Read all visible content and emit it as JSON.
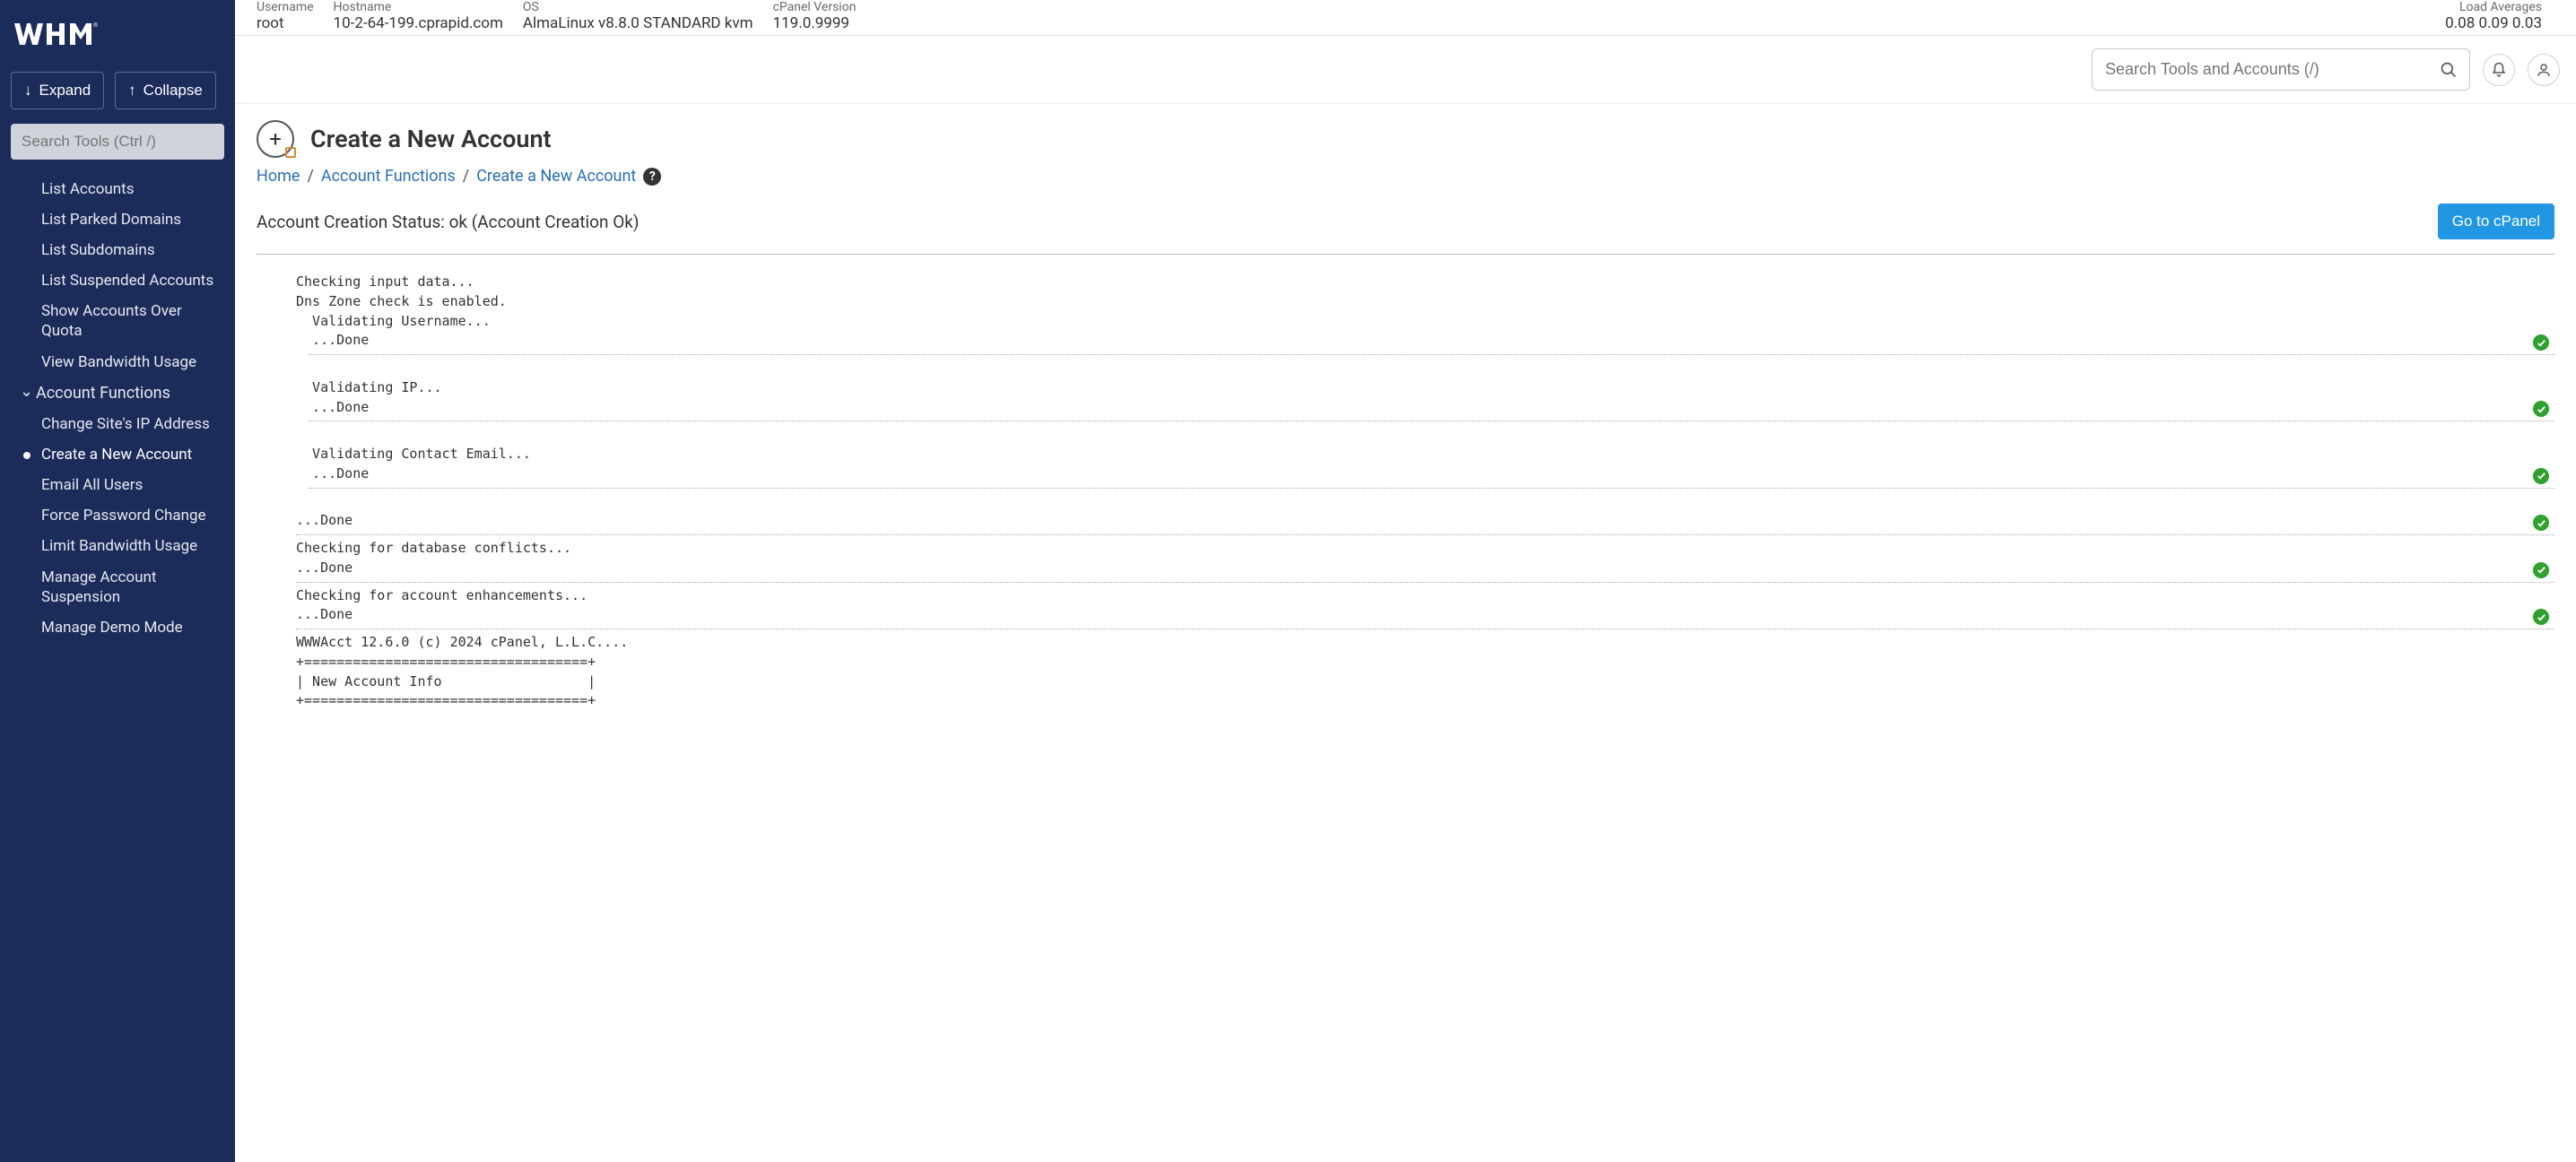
{
  "topbar": {
    "username_label": "Username",
    "username_value": "root",
    "hostname_label": "Hostname",
    "hostname_value": "10-2-64-199.cprapid.com",
    "os_label": "OS",
    "os_value": "AlmaLinux v8.8.0 STANDARD kvm",
    "cpv_label": "cPanel Version",
    "cpv_value": "119.0.9999",
    "load_label": "Load Averages",
    "load_values": "0.08   0.09   0.03"
  },
  "sidebar": {
    "expand": "Expand",
    "collapse": "Collapse",
    "search_placeholder": "Search Tools (Ctrl /)",
    "items_top": [
      "List Accounts",
      "List Parked Domains",
      "List Subdomains",
      "List Suspended Accounts",
      "Show Accounts Over Quota",
      "View Bandwidth Usage"
    ],
    "category": "Account Functions",
    "items_bottom": [
      "Change Site's IP Address",
      "Create a New Account",
      "Email All Users",
      "Force Password Change",
      "Limit Bandwidth Usage",
      "Manage Account Suspension",
      "Manage Demo Mode"
    ]
  },
  "tools": {
    "search_placeholder": "Search Tools and Accounts (/)"
  },
  "page": {
    "title": "Create a New Account",
    "breadcrumb": {
      "home": "Home",
      "func": "Account Functions",
      "current": "Create a New Account"
    },
    "status": "Account Creation Status: ok (Account Creation Ok)",
    "go_btn": "Go to cPanel"
  },
  "log": {
    "l0": "Checking input data...",
    "l1": "Dns Zone check is enabled.",
    "g1a": "  Validating Username...",
    "g1b": "  ...Done",
    "g2a": "  Validating IP...",
    "g2b": "  ...Done",
    "g3a": "  Validating Contact Email...",
    "g3b": "  ...Done",
    "l2": "...Done",
    "l3a": "Checking for database conflicts...",
    "l3b": "...Done",
    "l4a": "Checking for account enhancements...",
    "l4b": "...Done",
    "l5": "WWWAcct 12.6.0 (c) 2024 cPanel, L.L.C....",
    "l6": "",
    "l7": "+===================================+",
    "l8": "| New Account Info                  |",
    "l9": "+===================================+"
  }
}
